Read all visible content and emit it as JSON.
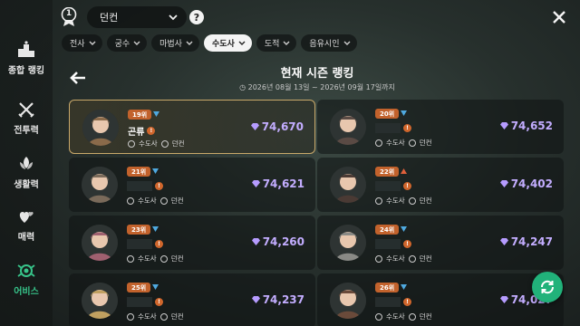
{
  "sidebar": {
    "items": [
      {
        "label": "종합 랭킹",
        "icon": "podium-icon"
      },
      {
        "label": "전투력",
        "icon": "crossed-swords-icon"
      },
      {
        "label": "생활력",
        "icon": "leaf-emblem-icon"
      },
      {
        "label": "매력",
        "icon": "hearts-icon"
      },
      {
        "label": "어비스",
        "icon": "abyss-emblem-icon",
        "active": true
      }
    ]
  },
  "header": {
    "rank_badge_number": "1",
    "server": "던컨",
    "help": "?"
  },
  "filters": [
    {
      "label": "전사"
    },
    {
      "label": "궁수"
    },
    {
      "label": "마법사"
    },
    {
      "label": "수도사",
      "selected": true
    },
    {
      "label": "도적"
    },
    {
      "label": "음유시인"
    }
  ],
  "season": {
    "title": "현재 시즌 랭킹",
    "period": "2026년 08월 13일 ~ 2026년 09월 17일까지"
  },
  "ranking": [
    {
      "rank": "19위",
      "name": "곤류",
      "class": "수도사",
      "server": "던컨",
      "score": "74,670",
      "trend": "down",
      "me": true
    },
    {
      "rank": "20위",
      "name": "",
      "class": "수도사",
      "server": "던컨",
      "score": "74,652",
      "trend": "down"
    },
    {
      "rank": "21위",
      "name": "",
      "class": "수도사",
      "server": "던컨",
      "score": "74,621",
      "trend": "down"
    },
    {
      "rank": "22위",
      "name": "",
      "class": "수도사",
      "server": "던컨",
      "score": "74,402",
      "trend": "up"
    },
    {
      "rank": "23위",
      "name": "",
      "class": "수도사",
      "server": "던컨",
      "score": "74,260",
      "trend": "down"
    },
    {
      "rank": "24위",
      "name": "",
      "class": "수도사",
      "server": "던컨",
      "score": "74,247",
      "trend": "down"
    },
    {
      "rank": "25위",
      "name": "",
      "class": "수도사",
      "server": "던컨",
      "score": "74,237",
      "trend": "down"
    },
    {
      "rank": "26위",
      "name": "",
      "class": "수도사",
      "server": "던컨",
      "score": "74,027",
      "trend": "down"
    }
  ],
  "colors": {
    "accent_green": "#21b27a",
    "rank_orange": "#c2622c",
    "score_purple": "#c3adff",
    "trend_down": "#4fa9e0",
    "trend_up": "#e0603a",
    "highlight_gold": "#c9a96a"
  }
}
